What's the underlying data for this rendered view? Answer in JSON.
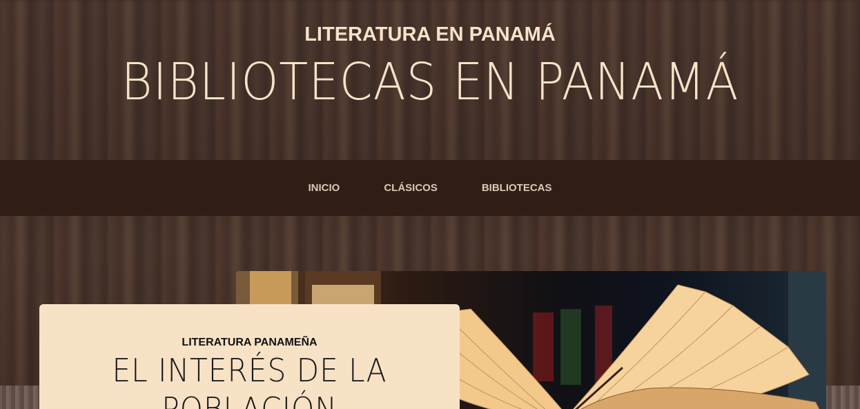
{
  "header": {
    "upper": "LITERATURA EN PANAMÁ",
    "title": "BIBLIOTECAS EN PANAMÁ"
  },
  "nav": {
    "items": [
      {
        "label": "INICIO"
      },
      {
        "label": "CLÁSICOS"
      },
      {
        "label": "BIBLIOTECAS"
      }
    ]
  },
  "card": {
    "kicker": "LITERATURA PANAMEÑA",
    "title": "EL INTERÉS DE LA POBLACIÓN"
  },
  "colors": {
    "nav_bg": "#2f1d16",
    "header_text": "#f7e3c8",
    "card_bg": "#f7e2c6"
  }
}
